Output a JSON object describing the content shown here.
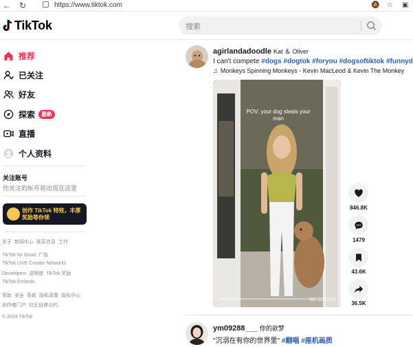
{
  "browser": {
    "url": "https://www.tiktok.com"
  },
  "brand": {
    "name": "TikTok",
    "accent": "#fe2c55"
  },
  "search": {
    "placeholder": "搜索"
  },
  "nav": [
    {
      "label": "推荐",
      "icon": "home-icon",
      "active": true
    },
    {
      "label": "已关注",
      "icon": "following-icon"
    },
    {
      "label": "好友",
      "icon": "friends-icon"
    },
    {
      "label": "探索",
      "icon": "explore-icon",
      "badge": "最新"
    },
    {
      "label": "直播",
      "icon": "live-icon"
    },
    {
      "label": "个人资料",
      "icon": "profile-icon"
    }
  ],
  "follow": {
    "title": "关注账号",
    "subtitle": "你关注的帐号将出现在这里"
  },
  "promo": {
    "text": "创作 TikTok 特效，丰厚奖励等你领"
  },
  "footer": [
    [
      "关于",
      "新闻中心",
      "联系信息",
      "工作"
    ],
    [
      "TikTok for Good",
      "广告"
    ],
    [
      "TikTok LIVE Creator Networks"
    ],
    [
      "Developers",
      "透明度",
      "TikTok 奖励"
    ],
    [
      "TikTok Embeds"
    ],
    [
      "帮助",
      "安全",
      "条款",
      "隐私政策",
      "隐私中心"
    ],
    [
      "创作者门户",
      "社区自律公约"
    ],
    [
      "© 2024 TikTok"
    ]
  ],
  "posts": [
    {
      "username": "agirlandadoodle",
      "nickname": "Kat ＆ Oliver",
      "caption_text": "I can't compete ",
      "hashtags": "#dogs #dogtok #foryou #dogsoftiktok #funnydo",
      "music": "Monkeys Spinning Monkeys - Kevin MacLeod & Kevin The Monkey",
      "video_caption": "POV: your dog steals your man",
      "video_time": "00:00/00:15",
      "likes": "846.8K",
      "comments": "1479",
      "saves": "43.6K",
      "shares": "36.5K"
    },
    {
      "username": "ym09288___",
      "nickname": "你的欲梦",
      "caption_text": "\"沉溺在有你的世界里\" ",
      "hashtags": "#翻唱 #座机画质"
    }
  ]
}
